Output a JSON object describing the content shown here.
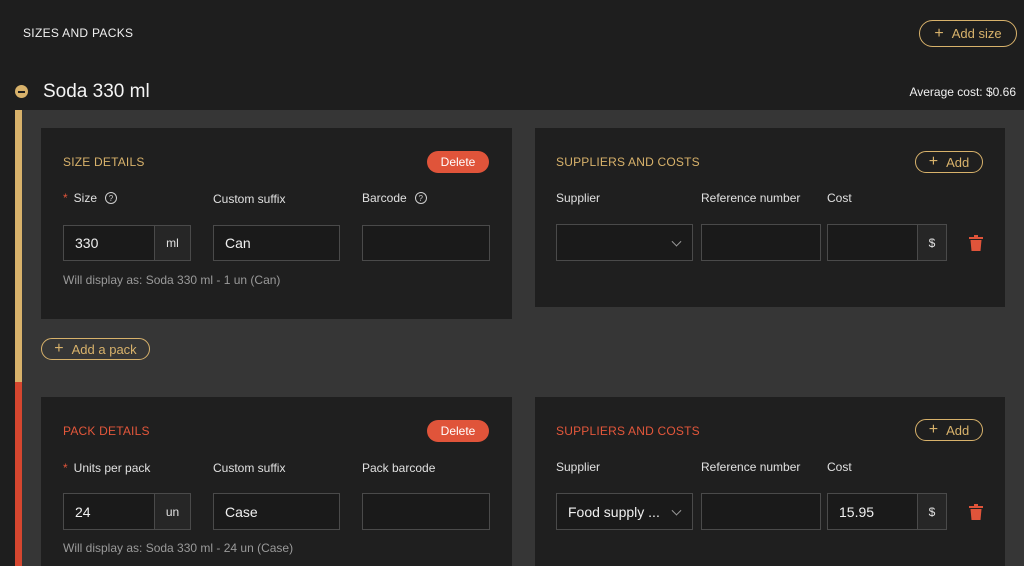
{
  "header": {
    "section_title": "SIZES AND PACKS",
    "add_size_label": "Add size"
  },
  "product": {
    "name": "Soda 330 ml",
    "average_cost": "Average cost: $0.66"
  },
  "size_details": {
    "title": "SIZE DETAILS",
    "delete_label": "Delete",
    "size_label": "Size",
    "size_value": "330",
    "size_unit": "ml",
    "suffix_label": "Custom suffix",
    "suffix_value": "Can",
    "barcode_label": "Barcode",
    "barcode_value": "",
    "hint": "Will display as: Soda 330 ml - 1 un (Can)"
  },
  "size_suppliers": {
    "title": "SUPPLIERS AND COSTS",
    "add_label": "Add",
    "supplier_label": "Supplier",
    "reference_label": "Reference number",
    "cost_label": "Cost",
    "supplier_value": "",
    "reference_value": "",
    "cost_value": "",
    "currency": "$"
  },
  "add_pack_label": "Add a pack",
  "pack_details": {
    "title": "PACK DETAILS",
    "delete_label": "Delete",
    "units_label": "Units per pack",
    "units_value": "24",
    "units_unit": "un",
    "suffix_label": "Custom suffix",
    "suffix_value": "Case",
    "barcode_label": "Pack barcode",
    "barcode_value": "",
    "hint": "Will display as: Soda 330 ml - 24 un (Case)"
  },
  "pack_suppliers": {
    "title": "SUPPLIERS AND COSTS",
    "add_label": "Add",
    "supplier_label": "Supplier",
    "reference_label": "Reference number",
    "cost_label": "Cost",
    "supplier_value": "Food supply ...",
    "reference_value": "",
    "cost_value": "15.95",
    "currency": "$"
  },
  "colors": {
    "gold": "#d8b26b",
    "red": "#e0543a",
    "background": "#1e1e1e",
    "panel": "#1f1f1f"
  }
}
